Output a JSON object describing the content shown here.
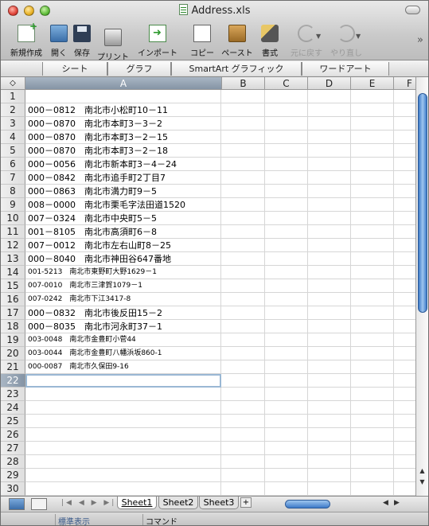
{
  "window": {
    "title": "Address.xls"
  },
  "toolbar": {
    "new": "新規作成",
    "open": "開く",
    "save": "保存",
    "print": "プリント",
    "import": "インポート",
    "copy": "コピー",
    "paste": "ペースト",
    "format": "書式",
    "undo": "元に戻す",
    "redo": "やり直し"
  },
  "ribbon": {
    "tabs": [
      "シート",
      "グラフ",
      "SmartArt グラフィック",
      "ワードアート"
    ]
  },
  "columns": [
    "A",
    "B",
    "C",
    "D",
    "E",
    "F"
  ],
  "rows": [
    {
      "n": "1",
      "a": ""
    },
    {
      "n": "2",
      "a": "000－0812　南北市小松町10－11"
    },
    {
      "n": "3",
      "a": "000－0870　南北市本町3－3－2"
    },
    {
      "n": "4",
      "a": "000－0870　南北市本町3－2－15"
    },
    {
      "n": "5",
      "a": "000－0870　南北市本町3－2－18"
    },
    {
      "n": "6",
      "a": "000－0056　南北市新本町3－4－24"
    },
    {
      "n": "7",
      "a": "000－0842　南北市追手町2丁目7"
    },
    {
      "n": "8",
      "a": "000－0863　南北市満力町9－5"
    },
    {
      "n": "9",
      "a": "008－0000　南北市栗毛字法田道1520"
    },
    {
      "n": "10",
      "a": "007－0324　南北市中央町5－5"
    },
    {
      "n": "11",
      "a": "001－8105　南北市高須町6－8"
    },
    {
      "n": "12",
      "a": "007－0012　南北市左右山町8－25"
    },
    {
      "n": "13",
      "a": "000－8040　南北市神田谷647番地"
    },
    {
      "n": "14",
      "a": "001-5213　南北市東野町大野1629－1"
    },
    {
      "n": "15",
      "a": "007-0010　南北市三津賀1079－1"
    },
    {
      "n": "16",
      "a": "007-0242　南北市下江3417-8"
    },
    {
      "n": "17",
      "a": "000－0832　南北市後反田15－2"
    },
    {
      "n": "18",
      "a": "000－8035　南北市河永町37－1"
    },
    {
      "n": "19",
      "a": "003-0048　南北市金豊町小菅44"
    },
    {
      "n": "20",
      "a": "003-0044　南北市金豊町八幡浜坂860-1"
    },
    {
      "n": "21",
      "a": "000-0087　南北市久保田9-16"
    },
    {
      "n": "22",
      "a": ""
    },
    {
      "n": "23",
      "a": ""
    },
    {
      "n": "24",
      "a": ""
    },
    {
      "n": "25",
      "a": ""
    },
    {
      "n": "26",
      "a": ""
    },
    {
      "n": "27",
      "a": ""
    },
    {
      "n": "28",
      "a": ""
    },
    {
      "n": "29",
      "a": ""
    },
    {
      "n": "30",
      "a": ""
    }
  ],
  "active_row": "22",
  "sheets": [
    "Sheet1",
    "Sheet2",
    "Sheet3"
  ],
  "add_sheet": "+",
  "status": {
    "view": "標準表示",
    "mode": "コマンド"
  }
}
